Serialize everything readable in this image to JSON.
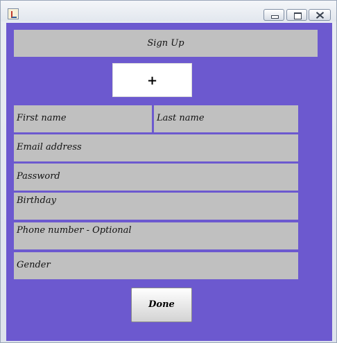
{
  "window": {
    "title": "",
    "controls": {
      "minimize_icon": "minimize-icon",
      "maximize_icon": "maximize-icon",
      "close_icon": "close-icon"
    }
  },
  "colors": {
    "background": "#6c59cf",
    "field": "#c0c0c0"
  },
  "form": {
    "signup_label": "Sign Up",
    "add_photo_label": "+",
    "first_name": "First name",
    "last_name": "Last name",
    "email": "Email address",
    "password": "Password",
    "birthday": "Birthday",
    "phone": "Phone number - Optional",
    "gender": "Gender",
    "done_label": "Done"
  }
}
